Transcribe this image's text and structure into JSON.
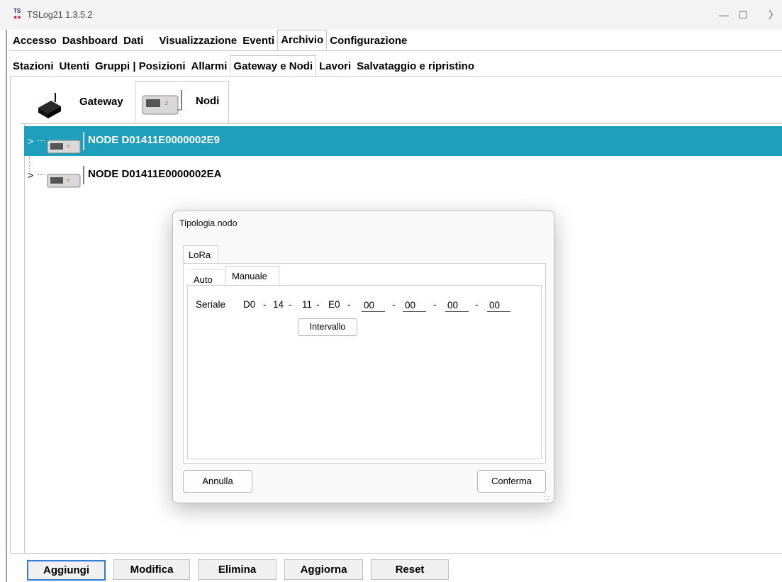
{
  "window": {
    "app_icon_top": "TS",
    "title": "TSLog21  1.3.5.2",
    "minimize": "—",
    "maximize": "☐",
    "more": "〉"
  },
  "main_tabs": [
    {
      "label": "Accesso"
    },
    {
      "label": "Dashboard"
    },
    {
      "label": "Dati"
    },
    {
      "label": "Visualizzazione"
    },
    {
      "label": "Eventi"
    },
    {
      "label": "Archivio",
      "active": true
    },
    {
      "label": "Configurazione"
    }
  ],
  "sub_tabs": [
    {
      "label": "Stazioni"
    },
    {
      "label": "Utenti"
    },
    {
      "label": "Gruppi | Posizioni"
    },
    {
      "label": "Allarmi"
    },
    {
      "label": "Gateway e Nodi",
      "active": true
    },
    {
      "label": "Lavori"
    },
    {
      "label": "Salvataggio e ripristino"
    }
  ],
  "inner_tabs": {
    "gateway": "Gateway",
    "nodi": "Nodi",
    "active": "nodi"
  },
  "nodes": [
    {
      "label": "NODE D01411E0000002E9",
      "selected": true
    },
    {
      "label": "NODE D01411E0000002EA",
      "selected": false
    }
  ],
  "bottom_buttons": {
    "aggiungi": "Aggiungi",
    "modifica": "Modifica",
    "elimina": "Elimina",
    "aggiorna": "Aggiorna",
    "reset": "Reset"
  },
  "dialog": {
    "title": "Tipologia nodo",
    "outer_tab": "LoRa",
    "tabs": {
      "auto": "Auto",
      "manuale": "Manuale",
      "active": "manuale"
    },
    "serial_label": "Seriale",
    "fixed_segments": [
      "D0",
      "14",
      "11",
      "E0"
    ],
    "separator": "-",
    "editable_segments": [
      "00",
      "00",
      "00",
      "00"
    ],
    "interval_button": "Intervallo",
    "cancel_button": "Annulla",
    "confirm_button": "Conferma"
  },
  "colors": {
    "selection": "#1e9fbc",
    "focus_border": "#2f7bd6"
  }
}
